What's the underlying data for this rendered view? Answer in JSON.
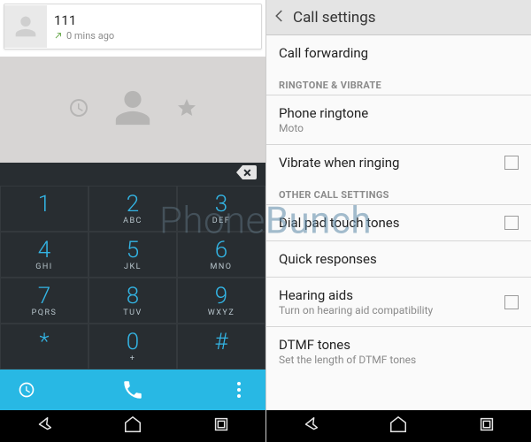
{
  "watermark": {
    "a": "Phone",
    "b": "Bunch"
  },
  "left": {
    "recent": {
      "number": "111",
      "time": "0 mins ago"
    },
    "keys": [
      {
        "d": "1",
        "l": ""
      },
      {
        "d": "2",
        "l": "ABC"
      },
      {
        "d": "3",
        "l": "DEF"
      },
      {
        "d": "4",
        "l": "GHI"
      },
      {
        "d": "5",
        "l": "JKL"
      },
      {
        "d": "6",
        "l": "MNO"
      },
      {
        "d": "7",
        "l": "PQRS"
      },
      {
        "d": "8",
        "l": "TUV"
      },
      {
        "d": "9",
        "l": "WXYZ"
      },
      {
        "d": "*",
        "l": ""
      },
      {
        "d": "0",
        "l": "+"
      },
      {
        "d": "#",
        "l": ""
      }
    ]
  },
  "right": {
    "title": "Call settings",
    "items": {
      "callForwarding": "Call forwarding",
      "sect1": "RINGTONE & VIBRATE",
      "ringtone": {
        "t": "Phone ringtone",
        "s": "Moto"
      },
      "vibrate": "Vibrate when ringing",
      "sect2": "OTHER CALL SETTINGS",
      "touchTones": "Dial pad touch tones",
      "quick": "Quick responses",
      "hearing": {
        "t": "Hearing aids",
        "s": "Turn on hearing aid compatibility"
      },
      "dtmf": {
        "t": "DTMF tones",
        "s": "Set the length of DTMF tones"
      }
    }
  }
}
